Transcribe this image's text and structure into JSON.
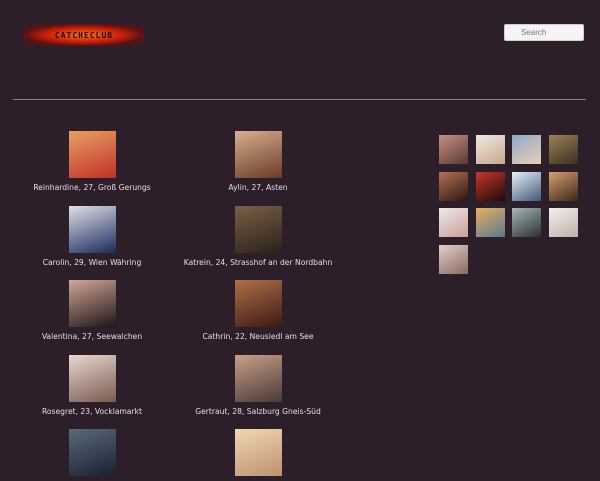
{
  "header": {
    "logo_text": "CATCHECLUB",
    "search_placeholder": "Search"
  },
  "profiles": [
    {
      "caption": "Reinhardine, 27, Groß Gerungs",
      "c1": "#e8a060",
      "c2": "#c0302a"
    },
    {
      "caption": "Aylin, 27, Asten",
      "c1": "#d8b090",
      "c2": "#6a3a28"
    },
    {
      "caption": "Carolin, 29, Wien Währing",
      "c1": "#e0e0ea",
      "c2": "#1a2a5a"
    },
    {
      "caption": "Katrein, 24, Strasshof an der Nordbahn",
      "c1": "#7a6048",
      "c2": "#2a2018"
    },
    {
      "caption": "Valentina, 27, Seewalchen",
      "c1": "#d0a898",
      "c2": "#201418"
    },
    {
      "caption": "Cathrin, 22, Neusiedl am See",
      "c1": "#b07048",
      "c2": "#3a1a14"
    },
    {
      "caption": "Rosegret, 23, Vocklamarkt",
      "c1": "#e8d8d0",
      "c2": "#7a5a50"
    },
    {
      "caption": "Gertraut, 28, Salzburg Gneis-Süd",
      "c1": "#c8a088",
      "c2": "#4a3a38"
    },
    {
      "caption": "",
      "c1": "#5a6a7a",
      "c2": "#1a2030"
    },
    {
      "caption": "",
      "c1": "#f0d8b0",
      "c2": "#c09070"
    }
  ],
  "gallery": [
    {
      "c1": "#c89080",
      "c2": "#5a3a38"
    },
    {
      "c1": "#f0e8e0",
      "c2": "#c8a890"
    },
    {
      "c1": "#90a8c8",
      "c2": "#e8d0b8"
    },
    {
      "c1": "#a08058",
      "c2": "#3a3020"
    },
    {
      "c1": "#b87058",
      "c2": "#2a1810"
    },
    {
      "c1": "#c83828",
      "c2": "#1a0a0a"
    },
    {
      "c1": "#e8f0f8",
      "c2": "#405878"
    },
    {
      "c1": "#d8a070",
      "c2": "#3a2818"
    },
    {
      "c1": "#f0e8e8",
      "c2": "#c8a098"
    },
    {
      "c1": "#e8b060",
      "c2": "#5a7890"
    },
    {
      "c1": "#a8b8b0",
      "c2": "#2a3038"
    },
    {
      "c1": "#f4f0ee",
      "c2": "#c0b0a8"
    },
    {
      "c1": "#e0d0c8",
      "c2": "#8a6a60"
    }
  ]
}
